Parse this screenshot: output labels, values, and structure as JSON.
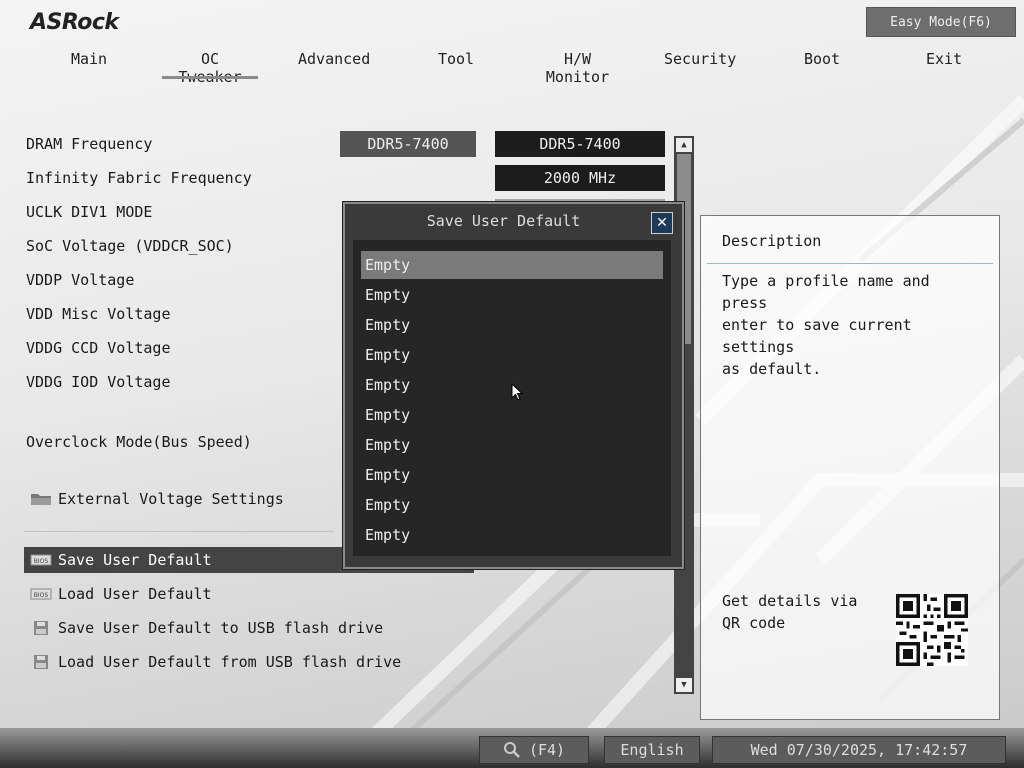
{
  "brand": "ASRock",
  "easy_mode": "Easy Mode(F6)",
  "tabs": [
    "Main",
    "OC Tweaker",
    "Advanced",
    "Tool",
    "H/W Monitor",
    "Security",
    "Boot",
    "Exit"
  ],
  "active_tab": "OC Tweaker",
  "settings": [
    {
      "label": "DRAM Frequency",
      "current": "DDR5-7400",
      "value": "DDR5-7400"
    },
    {
      "label": "Infinity Fabric Frequency",
      "value": "2000 MHz"
    },
    {
      "label": "UCLK DIV1 MODE"
    },
    {
      "label": "SoC Voltage (VDDCR_SOC)"
    },
    {
      "label": "VDDP Voltage"
    },
    {
      "label": "VDD Misc Voltage"
    },
    {
      "label": "VDDG CCD Voltage"
    },
    {
      "label": "VDDG IOD Voltage"
    },
    {
      "label": "Overclock Mode(Bus Speed)"
    }
  ],
  "submenu": {
    "label": "External Voltage Settings",
    "icon": "folder-icon"
  },
  "actions": [
    {
      "label": "Save User Default",
      "icon": "bios-chip-icon",
      "selected": true
    },
    {
      "label": "Load User Default",
      "icon": "bios-chip-icon",
      "selected": false
    },
    {
      "label": "Save User Default to USB flash drive",
      "icon": "floppy-icon",
      "selected": false
    },
    {
      "label": "Load User Default from USB flash drive",
      "icon": "floppy-icon",
      "selected": false
    }
  ],
  "description": {
    "title": "Description",
    "text": "Type a profile name and press\nenter to save current settings\nas default.",
    "qr_text": "Get details via QR code"
  },
  "dialog": {
    "title": "Save User Default",
    "close_icon": "close-icon",
    "slots": [
      "Empty",
      "Empty",
      "Empty",
      "Empty",
      "Empty",
      "Empty",
      "Empty",
      "Empty",
      "Empty",
      "Empty"
    ],
    "selected_index": 0
  },
  "bottom": {
    "search_label": "(F4)",
    "language": "English",
    "datetime": "Wed 07/30/2025, 17:42:57"
  },
  "colors": {
    "accent_dark": "#1c1c1c",
    "panel_grey": "#555555",
    "close_blue": "#1e3a5a"
  }
}
